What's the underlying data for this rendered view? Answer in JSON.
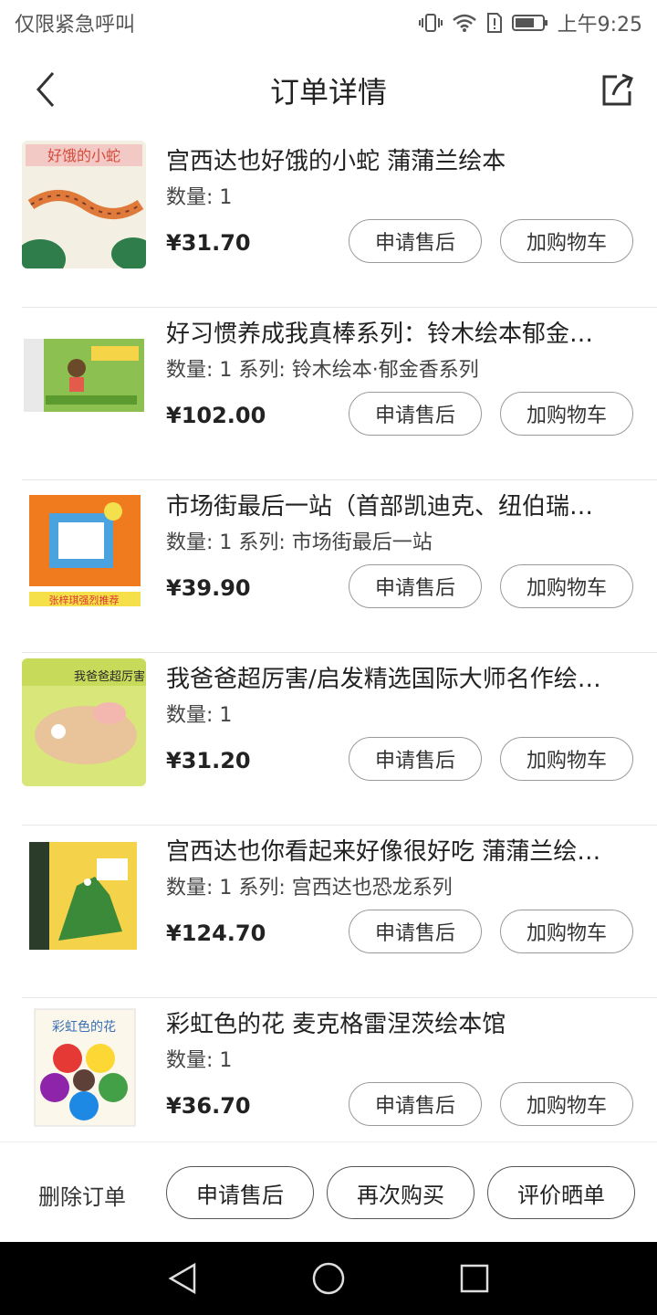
{
  "status_bar": {
    "left_text": "仅限紧急呼叫",
    "time": "上午9:25",
    "icons": [
      "vibrate-icon",
      "wifi-icon",
      "sim-alert-icon",
      "battery-icon"
    ]
  },
  "header": {
    "title": "订单详情",
    "back_icon": "chevron-left-icon",
    "share_icon": "share-icon"
  },
  "items": [
    {
      "title": "宫西达也好饿的小蛇 蒲蒲兰绘本",
      "meta": "数量: 1",
      "price": "¥31.70",
      "aftersale_label": "申请售后",
      "cart_label": "加购物车",
      "cover_text": "好饿的小蛇"
    },
    {
      "title": "好习惯养成我真棒系列：铃木绘本郁金…",
      "meta": "数量: 1 系列: 铃木绘本·郁金香系列",
      "price": "¥102.00",
      "aftersale_label": "申请售后",
      "cart_label": "加购物车",
      "cover_text": ""
    },
    {
      "title": "市场街最后一站（首部凯迪克、纽伯瑞…",
      "meta": "数量: 1 系列: 市场街最后一站",
      "price": "¥39.90",
      "aftersale_label": "申请售后",
      "cart_label": "加购物车",
      "cover_text": "张梓琪强烈推荐"
    },
    {
      "title": "我爸爸超厉害/启发精选国际大师名作绘…",
      "meta": "数量: 1",
      "price": "¥31.20",
      "aftersale_label": "申请售后",
      "cart_label": "加购物车",
      "cover_text": "我爸爸超厉害"
    },
    {
      "title": "宫西达也你看起来好像很好吃 蒲蒲兰绘…",
      "meta": "数量: 1 系列: 宫西达也恐龙系列",
      "price": "¥124.70",
      "aftersale_label": "申请售后",
      "cart_label": "加购物车",
      "cover_text": ""
    },
    {
      "title": "彩虹色的花 麦克格雷涅茨绘本馆",
      "meta": "数量: 1",
      "price": "¥36.70",
      "aftersale_label": "申请售后",
      "cart_label": "加购物车",
      "cover_text": "彩虹色的花"
    }
  ],
  "bottom_bar": {
    "delete_label": "删除订单",
    "aftersale_label": "申请售后",
    "rebuy_label": "再次购买",
    "review_label": "评价晒单"
  },
  "nav_bar": {
    "icons": [
      "back-triangle-icon",
      "home-circle-icon",
      "recents-square-icon"
    ]
  }
}
